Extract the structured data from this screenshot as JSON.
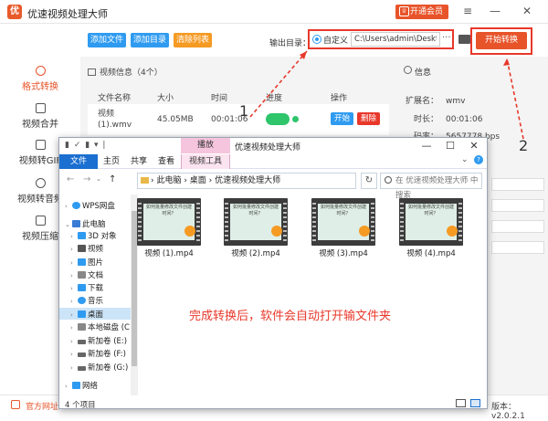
{
  "app": {
    "title": "优速视频处理大师",
    "logo_glyph": "优",
    "member_label": "开通会员",
    "member_icon": "crown-icon",
    "window_controls": [
      "≡",
      "—",
      "✕"
    ]
  },
  "toolbar": {
    "add_file": "添加文件",
    "add_dir": "添加目录",
    "clear_list": "清除列表",
    "output_label": "输出目录：",
    "custom_label": "自定义",
    "output_path": "C:\\Users\\admin\\Deskto",
    "more": "···",
    "start": "开始转换"
  },
  "sidebar": {
    "items": [
      {
        "label": "格式转换",
        "icon": "convert-icon",
        "active": true
      },
      {
        "label": "视频合并",
        "icon": "merge-icon"
      },
      {
        "label": "视频转GIF",
        "icon": "gif-icon"
      },
      {
        "label": "视频转音频",
        "icon": "audio-icon"
      },
      {
        "label": "视频压缩",
        "icon": "compress-icon"
      }
    ]
  },
  "list": {
    "header": "视频信息（4个）",
    "columns": [
      "文件名称",
      "大小",
      "时间",
      "进度",
      "操作"
    ],
    "rows": [
      {
        "name": "视频 (1).wmv",
        "size": "45.05MB",
        "time": "00:01:06",
        "start": "开始",
        "delete": "删除"
      }
    ]
  },
  "info": {
    "header": "信息",
    "fields": [
      {
        "k": "扩展名：",
        "v": "wmv"
      },
      {
        "k": "时长：",
        "v": "00:01:06"
      },
      {
        "k": "码率：",
        "v": "5657778 bps"
      }
    ]
  },
  "footer": {
    "site": "官方网址",
    "version": "版本：v2.0.2.1"
  },
  "annotations": {
    "one": "1",
    "two": "2"
  },
  "explorer": {
    "quick_access": "▮ ✓ ▮ ▾ |",
    "manage_tab": "播放",
    "title": "优速视频处理大师",
    "controls": [
      "—",
      "☐",
      "✕"
    ],
    "tabs": [
      "文件",
      "主页",
      "共享",
      "查看",
      "视频工具"
    ],
    "nav": {
      "back": "←",
      "forward": "→",
      "up": "↑"
    },
    "address": "› 此电脑 › 桌面 › 优速视频处理大师",
    "search_placeholder": "在 优速视频处理大师 中搜索",
    "tree": [
      {
        "label": "WPS网盘",
        "color": "#2f9bf0",
        "caret": "›"
      },
      {
        "label": "此电脑",
        "color": "#3a7bd5",
        "caret": "⌄"
      },
      {
        "label": "3D 对象",
        "color": "#2f9bf0",
        "caret": "›"
      },
      {
        "label": "视频",
        "color": "#555",
        "caret": "›"
      },
      {
        "label": "图片",
        "color": "#2f9bf0",
        "caret": "›"
      },
      {
        "label": "文档",
        "color": "#777",
        "caret": "›"
      },
      {
        "label": "下载",
        "color": "#2f9bf0",
        "caret": "›"
      },
      {
        "label": "音乐",
        "color": "#2f9bf0",
        "caret": "›"
      },
      {
        "label": "桌面",
        "color": "#2f9bf0",
        "caret": "›"
      },
      {
        "label": "本地磁盘 (C:)",
        "color": "#888",
        "caret": "›"
      },
      {
        "label": "新加卷 (E:)",
        "color": "#666",
        "caret": "›"
      },
      {
        "label": "新加卷 (F:)",
        "color": "#666",
        "caret": "›"
      },
      {
        "label": "新加卷 (G:)",
        "color": "#666",
        "caret": "›"
      },
      {
        "label": "网络",
        "color": "#2f9bf0",
        "caret": "›"
      }
    ],
    "files": [
      "视频 (1).mp4",
      "视频 (2).mp4",
      "视频 (3).mp4",
      "视频 (4).mp4"
    ],
    "thumb_caption": "如何批量修改文件创建时间？",
    "message": "完成转换后，软件会自动打开输文件夹",
    "status": "4 个项目"
  }
}
